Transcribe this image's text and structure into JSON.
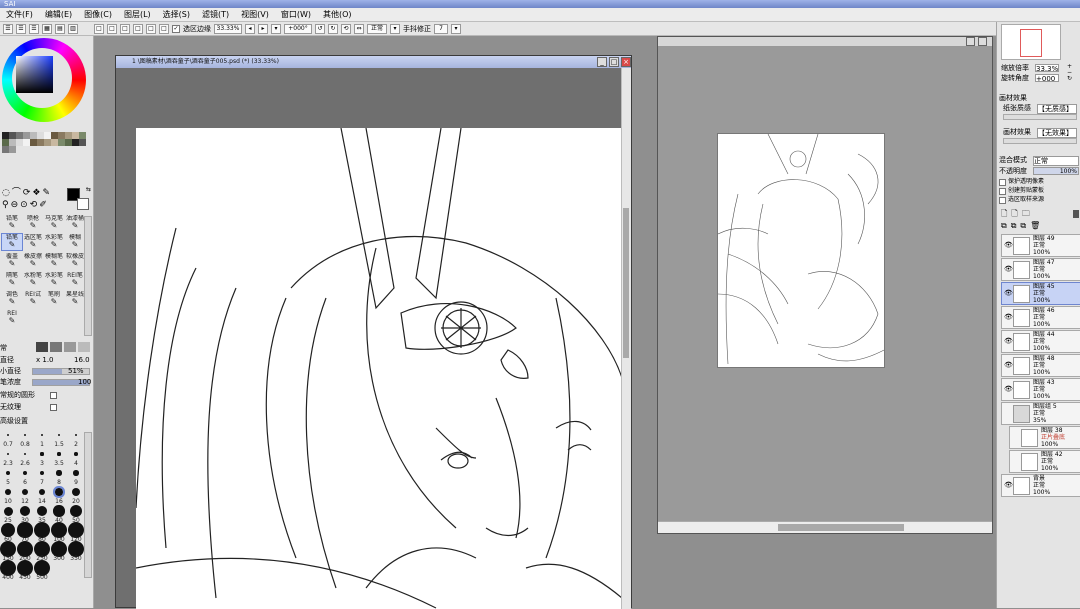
{
  "app": {
    "title": "SAI"
  },
  "menubar": {
    "items": [
      "文件(F)",
      "编辑(E)",
      "图像(C)",
      "图层(L)",
      "选择(S)",
      "滤镜(T)",
      "视图(V)",
      "窗口(W)",
      "其他(O)"
    ]
  },
  "toolbar": {
    "select_edge_label": "选区边缘",
    "zoom_value": "33.33%",
    "angle_value": "+000°",
    "mode_value": "正常",
    "stabilizer_label": "手抖修正",
    "stabilizer_value": "7"
  },
  "left_panel": {
    "tools": [
      {
        "label": "铅笔",
        "selected": false
      },
      {
        "label": "喷枪",
        "selected": false
      },
      {
        "label": "马克笔",
        "selected": false
      },
      {
        "label": "油漆桶",
        "selected": false
      },
      {
        "label": "铅笔",
        "selected": true
      },
      {
        "label": "选区笔",
        "selected": false
      },
      {
        "label": "水彩笔",
        "selected": false
      },
      {
        "label": "模糊",
        "selected": false
      },
      {
        "label": "覆盖",
        "selected": false
      },
      {
        "label": "橡皮擦",
        "selected": false
      },
      {
        "label": "模糊笔",
        "selected": false
      },
      {
        "label": "软橡皮",
        "selected": false
      },
      {
        "label": "隔笔",
        "selected": false
      },
      {
        "label": "水粉笔",
        "selected": false
      },
      {
        "label": "水彩笔",
        "selected": false
      },
      {
        "label": "REI笔",
        "selected": false
      },
      {
        "label": "调色",
        "selected": false
      },
      {
        "label": "REI试",
        "selected": false
      },
      {
        "label": "笔刷",
        "selected": false
      },
      {
        "label": "果星线",
        "selected": false
      },
      {
        "label": "REI",
        "selected": false
      }
    ],
    "mode_label": "常",
    "size_label": "直径",
    "size_mult": "x 1.0",
    "size_value": "16.0",
    "min_size_label": "小直径",
    "min_size_value": "51%",
    "density_label": "笔浓度",
    "density_value": "100",
    "shape_label": "常规的圆形",
    "texture_label": "无纹理",
    "advanced_label": "高级设置",
    "brush_sizes": [
      "0.7",
      "0.8",
      "1",
      "1.5",
      "2",
      "2.3",
      "2.6",
      "3",
      "3.5",
      "4",
      "5",
      "6",
      "7",
      "8",
      "9",
      "10",
      "12",
      "14",
      "16",
      "20",
      "25",
      "30",
      "35",
      "40",
      "50",
      "60",
      "70",
      "80",
      "100",
      "120",
      "150",
      "200",
      "250",
      "300",
      "350",
      "400",
      "450",
      "500"
    ],
    "selected_brush": "16"
  },
  "main_window": {
    "title": "1 \\图稿素材\\酒吞童子\\酒吞童子005.psd (*) (33.33%)"
  },
  "right_panel": {
    "zoom_label": "缩放倍率",
    "zoom_value": "33.3%",
    "rotate_label": "旋转角度",
    "rotate_value": "+000",
    "paper_effect_header": "画材效果",
    "texture_label": "纸张质感",
    "texture_value": "【无质感】",
    "effect_label": "画材效果",
    "effect_value": "【无效果】",
    "blend_label": "混合模式",
    "blend_value": "正常",
    "opacity_label": "不透明度",
    "opacity_value": "100%",
    "check1": "保护透明像素",
    "check2": "创建剪贴蒙板",
    "check3": "选区取样来源",
    "layers": [
      {
        "name": "图层 49",
        "mode": "正常",
        "opacity": "100%",
        "selected": false,
        "eye": true
      },
      {
        "name": "图层 47",
        "mode": "正常",
        "opacity": "100%",
        "selected": false,
        "eye": true
      },
      {
        "name": "图层 45",
        "mode": "正常",
        "opacity": "100%",
        "selected": true,
        "eye": true
      },
      {
        "name": "图层 46",
        "mode": "正常",
        "opacity": "100%",
        "selected": false,
        "eye": true
      },
      {
        "name": "图层 44",
        "mode": "正常",
        "opacity": "100%",
        "selected": false,
        "eye": true
      },
      {
        "name": "图层 48",
        "mode": "正常",
        "opacity": "100%",
        "selected": false,
        "eye": true
      },
      {
        "name": "图层 43",
        "mode": "正常",
        "opacity": "100%",
        "selected": false,
        "eye": true
      },
      {
        "name": "图层组 5",
        "mode": "正常",
        "opacity": "35%",
        "selected": false,
        "eye": false
      },
      {
        "name": "图层 38",
        "mode": "正片叠底",
        "opacity": "100%",
        "selected": false,
        "eye": false
      },
      {
        "name": "图层 42",
        "mode": "正常",
        "opacity": "100%",
        "selected": false,
        "eye": false
      },
      {
        "name": "背景",
        "mode": "正常",
        "opacity": "100%",
        "selected": false,
        "eye": true
      }
    ]
  },
  "colors": {
    "accent": "#6b86d4",
    "selection": "#c8d6f7",
    "title_bar": "#8fa3dc"
  }
}
